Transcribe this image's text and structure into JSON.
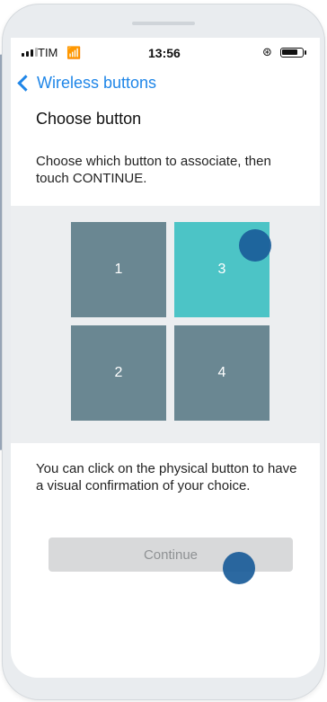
{
  "status_bar": {
    "carrier": "TIM",
    "time": "13:56"
  },
  "nav": {
    "back_label": "Wireless buttons"
  },
  "title": "Choose button",
  "instructions": "Choose which button to associate, then touch CONTINUE.",
  "buttons": [
    {
      "label": "1",
      "color": "#6a8792",
      "selected": false
    },
    {
      "label": "3",
      "color": "#4cc4c6",
      "selected": true
    },
    {
      "label": "2",
      "color": "#6a8792",
      "selected": false
    },
    {
      "label": "4",
      "color": "#6a8792",
      "selected": false
    }
  ],
  "hint": "You can click on the physical button to have a visual confirmation of your choice.",
  "continue_label": "Continue",
  "colors": {
    "accent": "#1f86e8",
    "selected_button": "#4cc4c6",
    "default_button": "#6a8792",
    "tap_indicator": "#1a5c99",
    "disabled_button_bg": "#d8d9da"
  }
}
